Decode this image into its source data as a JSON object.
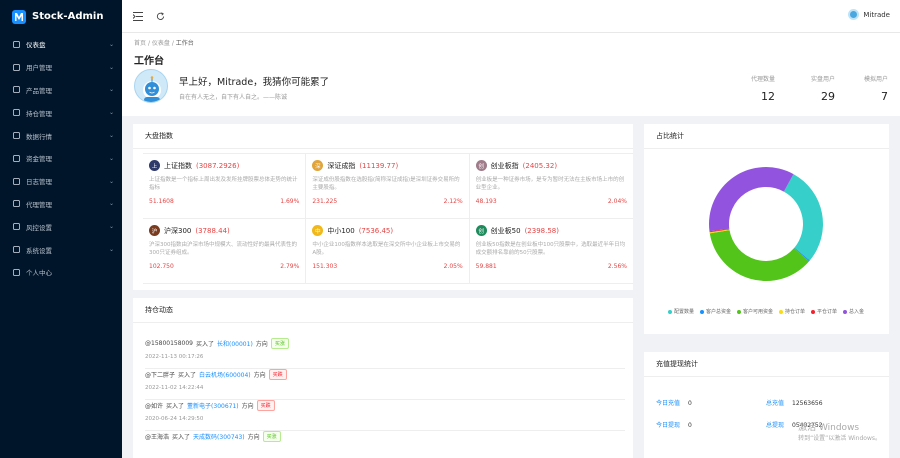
{
  "app": {
    "title": "Stock-Admin"
  },
  "sidebar": {
    "items": [
      {
        "label": "仪表盘",
        "icon": "dashboard-icon"
      },
      {
        "label": "用户管理",
        "icon": "user-manage-icon"
      },
      {
        "label": "产品管理",
        "icon": "product-icon"
      },
      {
        "label": "持仓管理",
        "icon": "position-icon"
      },
      {
        "label": "数据行情",
        "icon": "market-icon"
      },
      {
        "label": "资金管理",
        "icon": "fund-icon"
      },
      {
        "label": "日志管理",
        "icon": "log-icon"
      },
      {
        "label": "代理管理",
        "icon": "agent-icon"
      },
      {
        "label": "风控设置",
        "icon": "risk-icon"
      },
      {
        "label": "系统设置",
        "icon": "settings-icon"
      },
      {
        "label": "个人中心",
        "icon": "profile-icon"
      }
    ]
  },
  "header": {
    "user": "Mitrade"
  },
  "breadcrumb": [
    "首页",
    "仪表盘",
    "工作台"
  ],
  "page": {
    "title": "工作台",
    "greeting": "早上好，Mitrade，我猜你可能累了",
    "motto": "自在有人无之，自下有人自之。——陈诚"
  },
  "stats": [
    {
      "label": "代理数量",
      "value": "12"
    },
    {
      "label": "实盘用户",
      "value": "29"
    },
    {
      "label": "模拟用户",
      "value": "7"
    }
  ],
  "market": {
    "title": "大盘指数",
    "items": [
      {
        "icon": "上",
        "color": "#2f3a6b",
        "name": "上证指数",
        "price": "(3087.2926)",
        "desc": "上证指数是一个指标上周出发及发所挂牌股票总体走势的统计指标",
        "volume": "51.1608",
        "change": "1.69%"
      },
      {
        "icon": "深",
        "color": "#e0a43b",
        "name": "深证成指",
        "price": "(11139.77)",
        "desc": "深证成份股指数在选股指(简称深证成指)是深圳证券交易所的主要股指。",
        "volume": "231.225",
        "change": "2.12%"
      },
      {
        "icon": "创",
        "color": "#a07b8a",
        "name": "创业板指",
        "price": "(2405.32)",
        "desc": "创业板是一种证券市场，是专为暂时无法在主板市场上市的创业型企业。",
        "volume": "48.193",
        "change": "2.04%"
      },
      {
        "icon": "沪",
        "color": "#7a3b1e",
        "name": "沪深300",
        "price": "(3788.44)",
        "desc": "沪深300指数由沪深市场中规模大、流动性好的最具代表性的300只证券组成。",
        "volume": "102.750",
        "change": "2.79%"
      },
      {
        "icon": "中",
        "color": "#f0b81a",
        "name": "中小100",
        "price": "(7536.45)",
        "desc": "中小企业100指数样本选取是在深交所中小企业板上市交易的A股。",
        "volume": "151.303",
        "change": "2.05%"
      },
      {
        "icon": "创",
        "color": "#1f8a5c",
        "name": "创业板50",
        "price": "(2398.58)",
        "desc": "创业板50指数是在创业板中100只股票中，选取最近半年日均成交额排名靠前的50只股票。",
        "volume": "59.881",
        "change": "2.56%"
      }
    ]
  },
  "feed": {
    "title": "持仓动态",
    "items": [
      {
        "user": "@15800158009",
        "action": "买入了",
        "stock": "长和(00001)",
        "dir": "方向",
        "tag": "买涨",
        "type": "buy",
        "time": "2022-11-13 00:17:26"
      },
      {
        "user": "@下二胖子",
        "action": "买入了",
        "stock": "白云机场(600004)",
        "dir": "方向",
        "tag": "买跌",
        "type": "sell",
        "time": "2022-11-02 14:22:44"
      },
      {
        "user": "@如许",
        "action": "买入了",
        "stock": "董新电子(300671)",
        "dir": "方向",
        "tag": "买跌",
        "type": "sell",
        "time": "2020-06-24 14:29:50"
      },
      {
        "user": "@王海浩",
        "action": "买入了",
        "stock": "天成数码(300743)",
        "dir": "方向",
        "tag": "买涨",
        "type": "buy",
        "time": ""
      }
    ]
  },
  "ratio": {
    "title": "占比统计",
    "legend": [
      "配置数量",
      "客户总资金",
      "客户可用资金",
      "持仓订单",
      "平仓订单",
      "总入金"
    ]
  },
  "chart_data": {
    "type": "pie",
    "title": "占比统计",
    "categories": [
      "配置数量",
      "客户总资金",
      "客户可用资金",
      "持仓订单",
      "平仓订单",
      "总入金"
    ],
    "values": [
      28,
      0.3,
      36,
      0.3,
      0.3,
      35
    ],
    "colors": [
      "#36cfc9",
      "#1890ff",
      "#52c41a",
      "#fadb14",
      "#f5222d",
      "#9254de"
    ],
    "legend": "bottom"
  },
  "recharge": {
    "title": "充值提现统计",
    "rows": [
      {
        "label": "今日充值",
        "value": "0",
        "label2": "总充值",
        "value2": "12563656"
      },
      {
        "label": "今日提现",
        "value": "0",
        "label2": "总提现",
        "value2": "05402752"
      }
    ]
  },
  "watermark": {
    "line1": "激活 Windows",
    "line2": "转到“设置”以激活 Windows。"
  }
}
